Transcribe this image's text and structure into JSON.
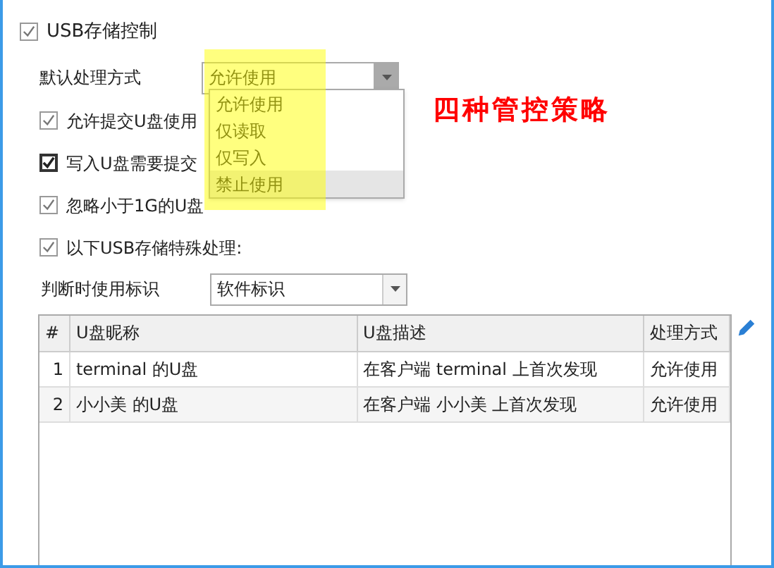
{
  "usb_control": {
    "label": "USB存储控制",
    "checked": true,
    "disabled": true
  },
  "default_action": {
    "label": "默认处理方式",
    "value": "允许使用",
    "expanded": true,
    "options": [
      {
        "label": "允许使用",
        "highlighted": false
      },
      {
        "label": "仅读取",
        "highlighted": false
      },
      {
        "label": "仅写入",
        "highlighted": false
      },
      {
        "label": "禁止使用",
        "highlighted": true
      }
    ]
  },
  "options": [
    {
      "label": "允许提交U盘使用",
      "checked": true,
      "disabled": true
    },
    {
      "label": "写入U盘需要提交",
      "checked": true,
      "disabled": false
    },
    {
      "label": "忽略小于1G的U盘",
      "checked": true,
      "disabled": true
    },
    {
      "label": "以下USB存储特殊处理:",
      "checked": true,
      "disabled": true
    }
  ],
  "identifier": {
    "label": "判断时使用标识",
    "value": "软件标识"
  },
  "annotation": "四种管控策略",
  "table": {
    "columns": [
      "#",
      "U盘昵称",
      "U盘描述",
      "处理方式"
    ],
    "rows": [
      [
        "1",
        "terminal 的U盘",
        "在客户端 terminal 上首次发现",
        "允许使用"
      ],
      [
        "2",
        "小小美 的U盘",
        "在客户端 小小美 上首次发现",
        "允许使用"
      ]
    ]
  }
}
